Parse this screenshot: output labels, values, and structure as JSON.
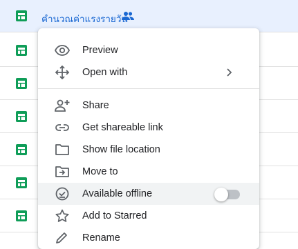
{
  "file_list": {
    "selected_file_name": "คำนวณค่าแรงรายวัน",
    "rows": [
      {
        "icon": "google-sheets-icon",
        "selected": true
      },
      {
        "icon": "google-sheets-icon"
      },
      {
        "icon": "google-sheets-icon"
      },
      {
        "icon": "google-sheets-icon"
      },
      {
        "icon": "google-sheets-icon"
      },
      {
        "icon": "google-sheets-icon"
      },
      {
        "icon": "google-sheets-icon"
      }
    ]
  },
  "context_menu": {
    "preview": "Preview",
    "open_with": "Open with",
    "share": "Share",
    "get_shareable_link": "Get shareable link",
    "show_file_location": "Show file location",
    "move_to": "Move to",
    "available_offline": "Available offline",
    "available_offline_enabled": false,
    "add_to_starred": "Add to Starred",
    "rename": "Rename"
  },
  "colors": {
    "sheets_green": "#0f9d58",
    "selection_bg": "#e8f0fe",
    "link_blue": "#1967d2",
    "icon_gray": "#5f6368"
  }
}
